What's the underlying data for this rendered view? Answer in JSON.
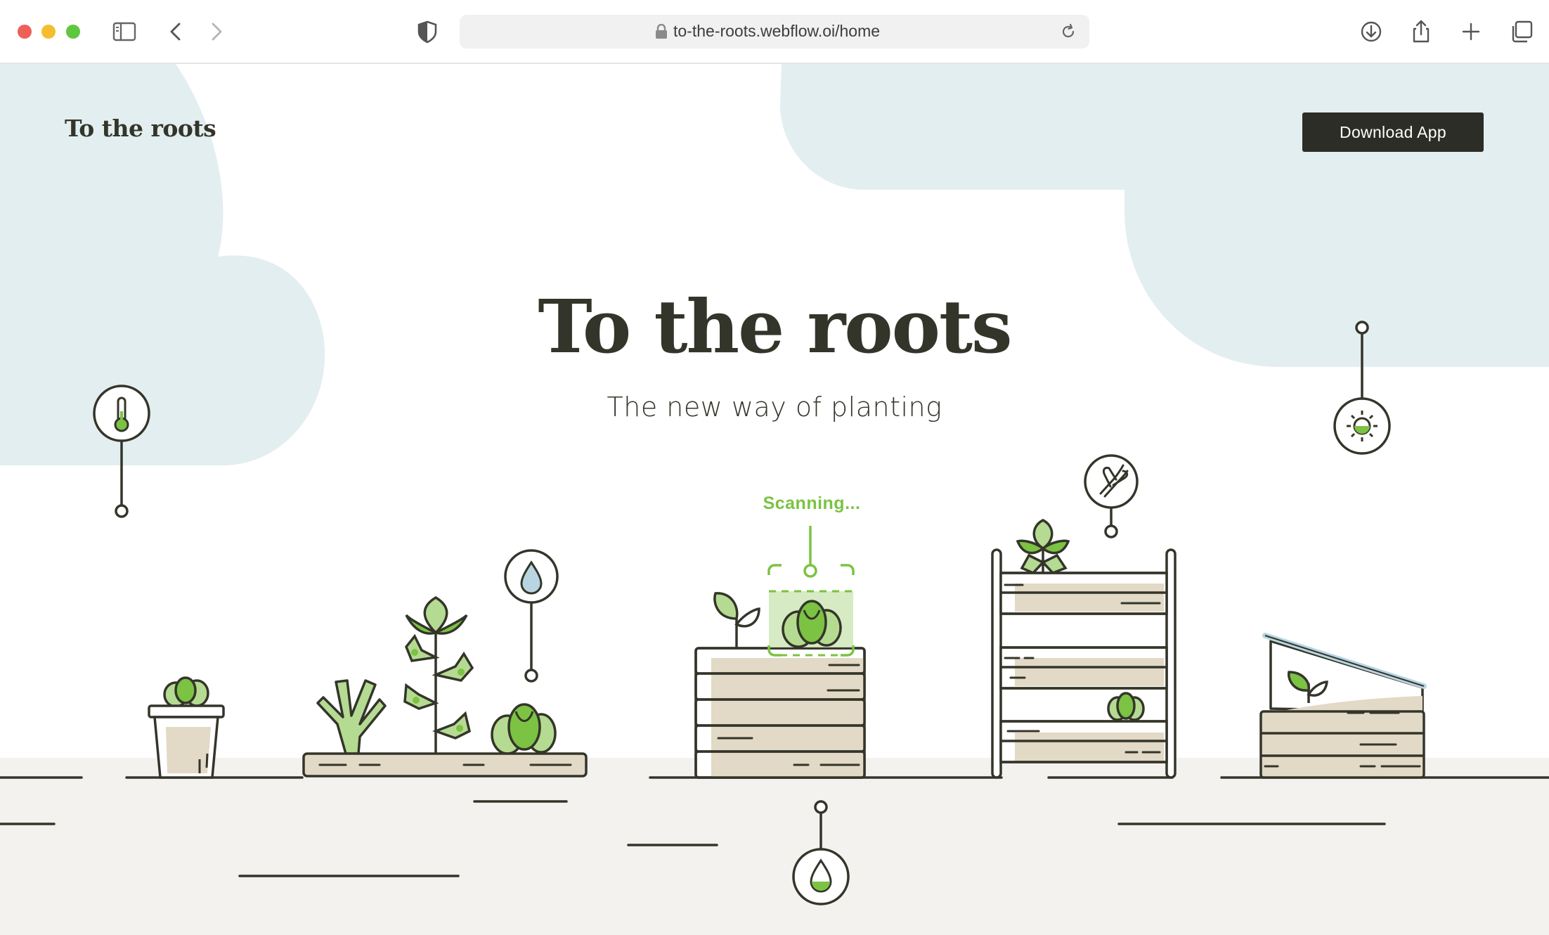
{
  "browser": {
    "url": "to-the-roots.webflow.oi/home",
    "icons": [
      "sidebar-icon",
      "back-icon",
      "forward-icon",
      "shield-icon",
      "lock-icon",
      "reload-icon",
      "download-icon",
      "share-icon",
      "new-tab-icon",
      "tabs-overview-icon"
    ]
  },
  "header": {
    "logo": "To the roots",
    "download_label": "Download App"
  },
  "hero": {
    "title": "To the roots",
    "subtitle": "The new way of planting"
  },
  "scene": {
    "scanning_label": "Scanning...",
    "sensor_icons": [
      "thermometer-icon",
      "water-drop-icon",
      "pruning-shears-icon",
      "sun-icon",
      "soil-moisture-icon"
    ]
  },
  "colors": {
    "ink": "#34352a",
    "cloud": "#e3eef0",
    "ground": "#f3f2ee",
    "soil": "#e2d9c6",
    "leaf_green": "#7cc243",
    "leaf_light": "#b5db92",
    "button_bg": "#2c2d26"
  }
}
